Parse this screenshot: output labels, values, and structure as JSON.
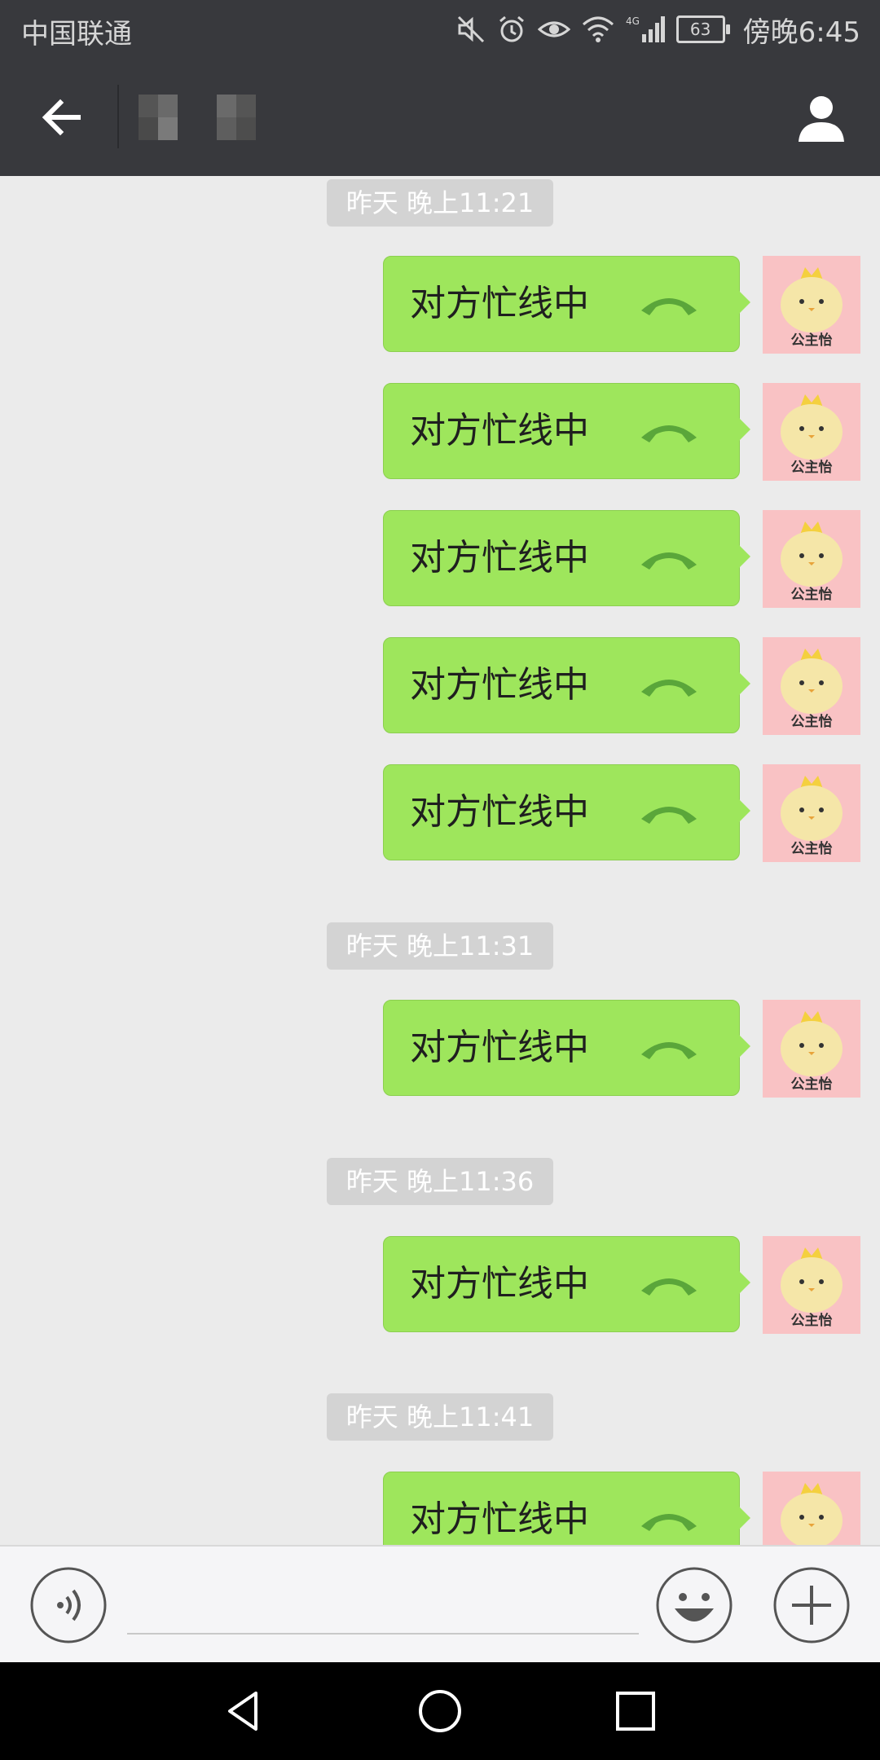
{
  "status_bar": {
    "carrier": "中国联通",
    "battery": "63",
    "time": "傍晚6:45",
    "icons": [
      "mute-icon",
      "alarm-icon",
      "eye-icon",
      "wifi-icon",
      "signal-4g-icon",
      "battery-icon"
    ]
  },
  "nav": {
    "back_icon": "arrow-left-icon",
    "title": "",
    "contact_icon": "person-icon"
  },
  "messages": [
    {
      "type": "time",
      "text": "昨天 晚上11:21"
    },
    {
      "type": "call",
      "text": "对方忙线中"
    },
    {
      "type": "call",
      "text": "对方忙线中"
    },
    {
      "type": "call",
      "text": "对方忙线中"
    },
    {
      "type": "call",
      "text": "对方忙线中"
    },
    {
      "type": "call",
      "text": "对方忙线中"
    },
    {
      "type": "time",
      "text": "昨天 晚上11:31"
    },
    {
      "type": "call",
      "text": "对方忙线中"
    },
    {
      "type": "time",
      "text": "昨天 晚上11:36"
    },
    {
      "type": "call",
      "text": "对方忙线中"
    },
    {
      "type": "time",
      "text": "昨天 晚上11:41"
    },
    {
      "type": "call",
      "text": "对方忙线中"
    }
  ],
  "avatar_label": "公主怡",
  "colors": {
    "bubble": "#9ee65c",
    "call_icon": "#5aa63a",
    "header": "#38393d",
    "avatar_bg": "#f9c2c4"
  },
  "input": {
    "value": "",
    "placeholder": ""
  }
}
